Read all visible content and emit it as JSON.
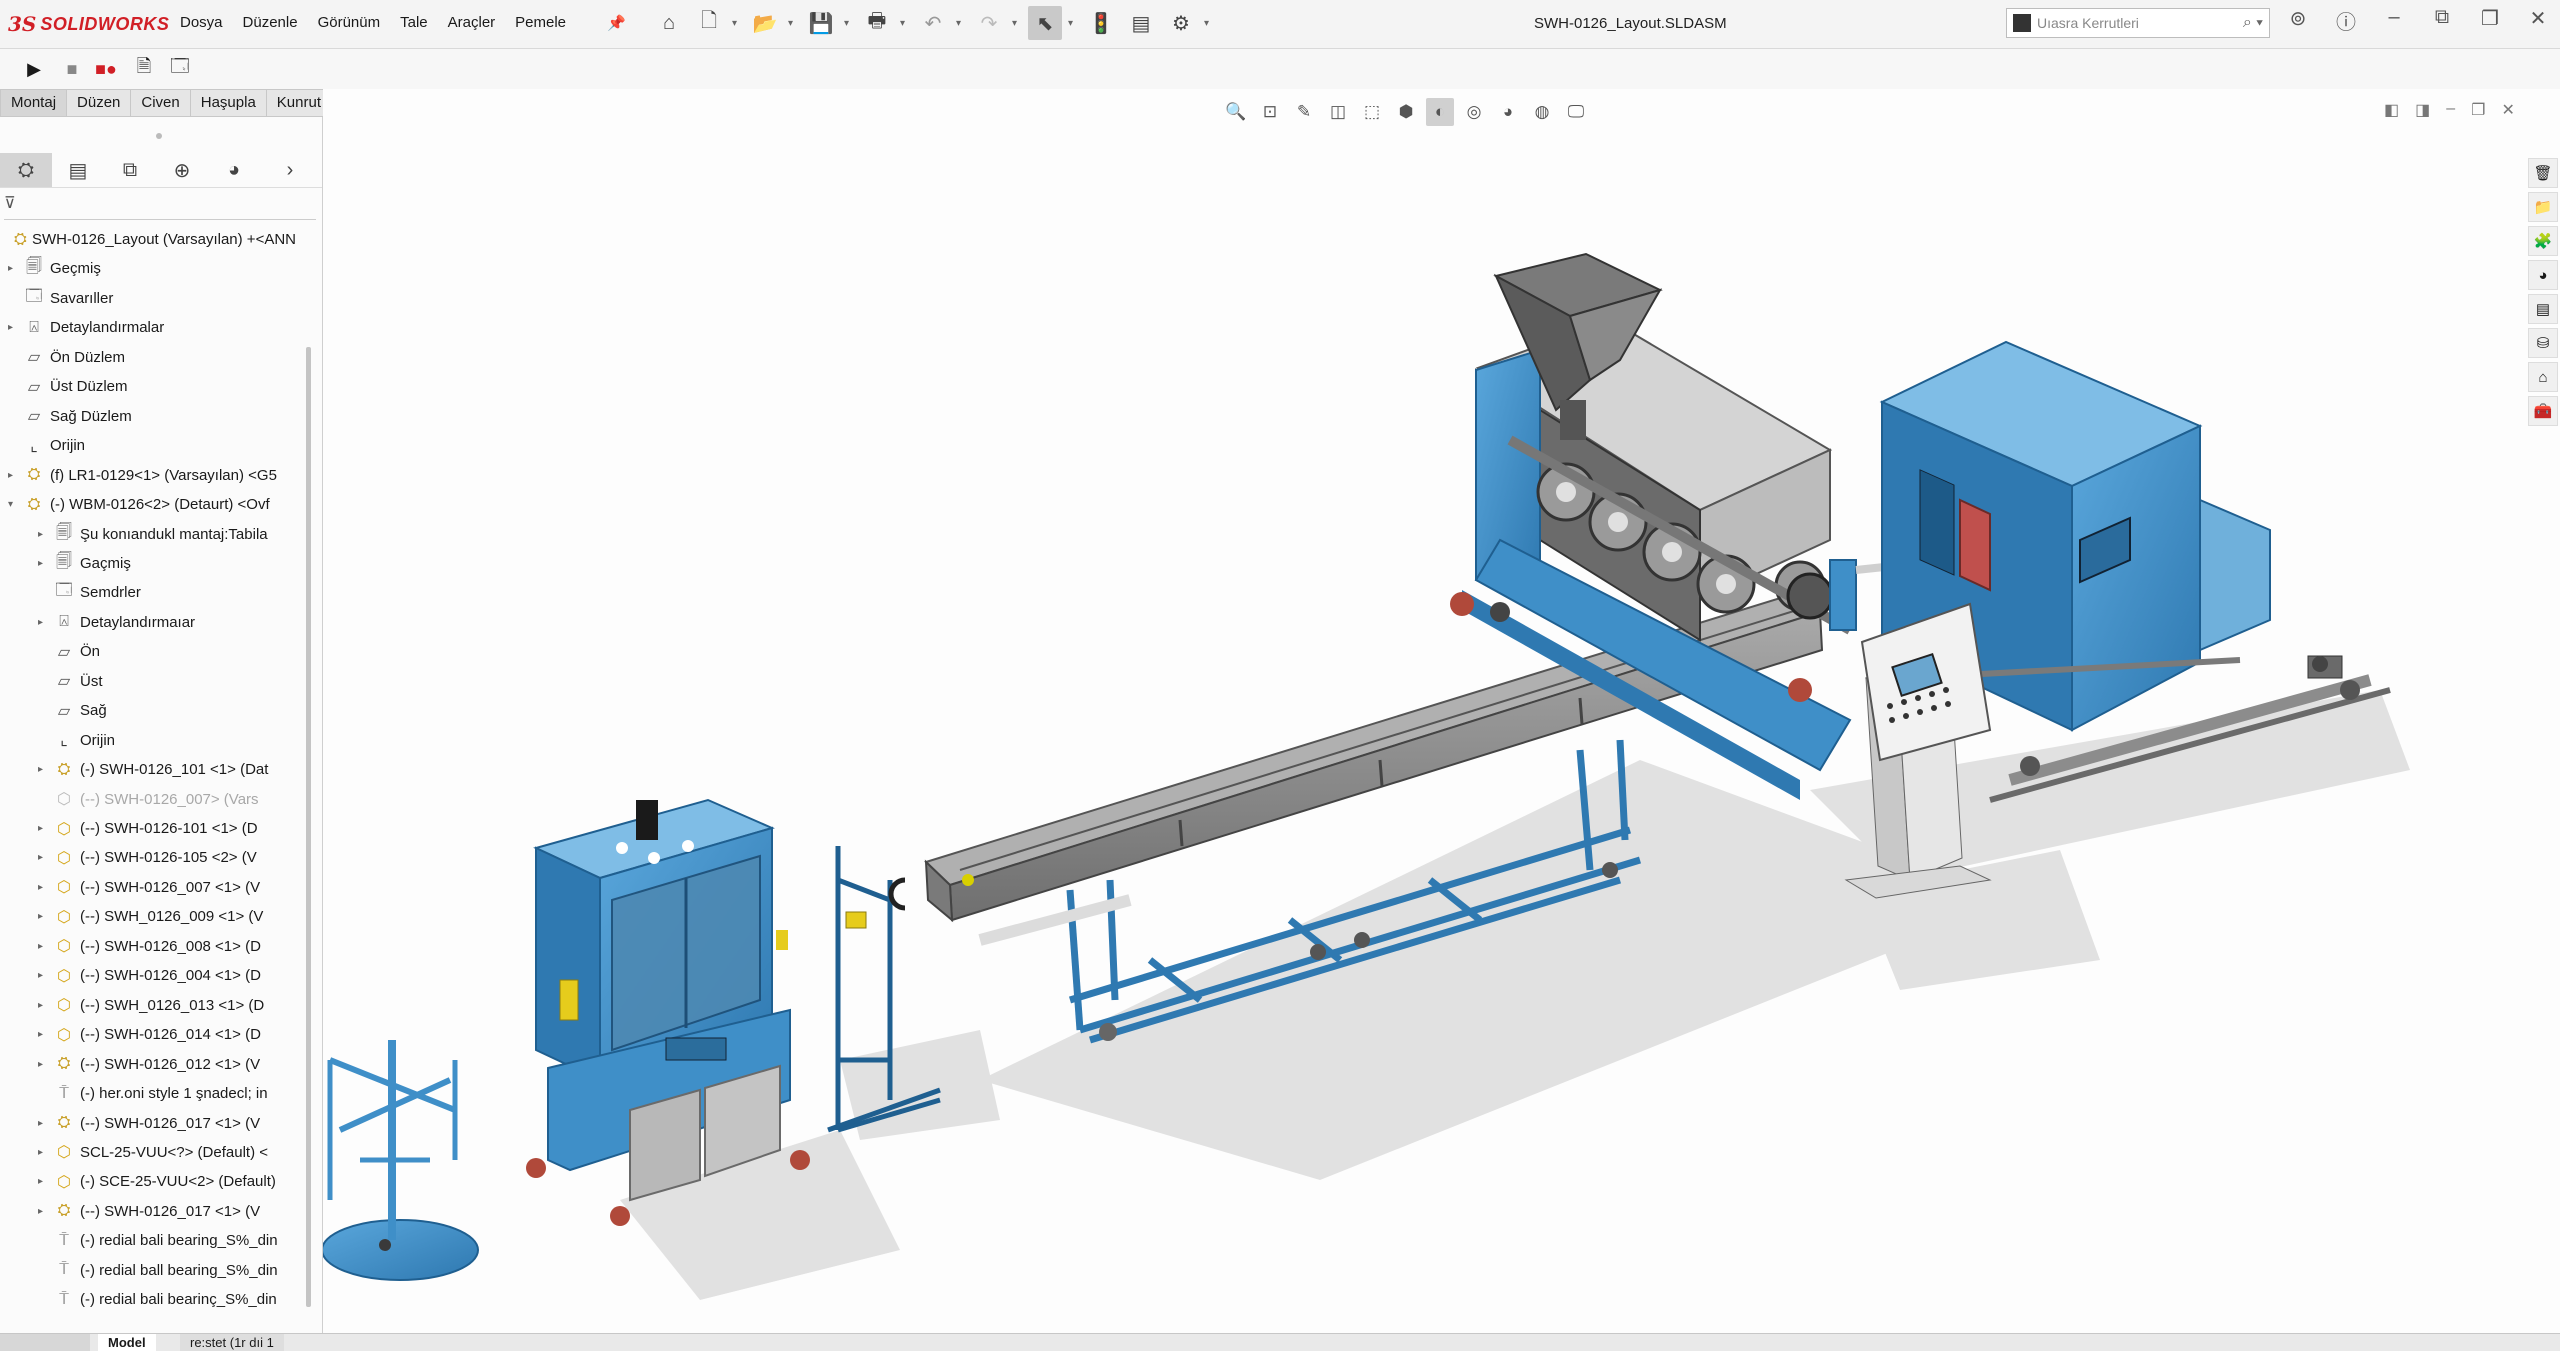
{
  "app": {
    "logo_prefix": "3S",
    "logo_name": "SOLIDWORKS"
  },
  "menu": [
    "Dosya",
    "Düzenle",
    "Görünüm",
    "Tale",
    "Araçler",
    "Pemele"
  ],
  "document_title": "SWH-0126_Layout.SLDASM",
  "search": {
    "placeholder": "Uıasra Kerrutleri"
  },
  "command_tabs": [
    "Montaj",
    "Düzen",
    "Civen",
    "Haşupla",
    "Kunrut Telentiri (Exita)"
  ],
  "active_command_tab": 0,
  "tree": [
    {
      "label": "SWH-0126_Layout (Varsayılan) +<ANN",
      "icon": "assembly-icon",
      "indent": 0,
      "expand": ""
    },
    {
      "label": "Geçmiş",
      "icon": "history-icon",
      "indent": 1,
      "expand": "▸"
    },
    {
      "label": "Savarıller",
      "icon": "sensors-icon",
      "indent": 1,
      "expand": ""
    },
    {
      "label": "Detaylandırmalar",
      "icon": "annotations-icon",
      "indent": 1,
      "expand": "▸"
    },
    {
      "label": "Ön Düzlem",
      "icon": "plane-icon",
      "indent": 1,
      "expand": ""
    },
    {
      "label": "Üst Düzlem",
      "icon": "plane-icon",
      "indent": 1,
      "expand": ""
    },
    {
      "label": "Sağ Düzlem",
      "icon": "plane-icon",
      "indent": 1,
      "expand": ""
    },
    {
      "label": "Orijin",
      "icon": "origin-icon",
      "indent": 1,
      "expand": ""
    },
    {
      "label": "(f) LR1-0129<1> (Varsayılan) <G5",
      "icon": "subassembly-icon",
      "indent": 1,
      "expand": "▸"
    },
    {
      "label": "(-) WBM-0126<2> (Detaurt) <Ovf",
      "icon": "subassembly-icon",
      "indent": 1,
      "expand": "▾"
    },
    {
      "label": "Şu konıandukl mantaj:Tabila",
      "icon": "history-icon",
      "indent": 2,
      "expand": "▸"
    },
    {
      "label": "Gaçmiş",
      "icon": "history-icon",
      "indent": 2,
      "expand": "▸"
    },
    {
      "label": "Semdrler",
      "icon": "sensors-icon",
      "indent": 2,
      "expand": ""
    },
    {
      "label": "Detaylandırmaıar",
      "icon": "annotations-icon",
      "indent": 2,
      "expand": "▸"
    },
    {
      "label": "Ön",
      "icon": "plane-icon",
      "indent": 2,
      "expand": ""
    },
    {
      "label": "Üst",
      "icon": "plane-icon",
      "indent": 2,
      "expand": ""
    },
    {
      "label": "Sağ",
      "icon": "plane-icon",
      "indent": 2,
      "expand": ""
    },
    {
      "label": "Orijin",
      "icon": "origin-icon",
      "indent": 2,
      "expand": ""
    },
    {
      "label": "(-) SWH-0126_101 <1> (Dat",
      "icon": "subassembly-icon",
      "indent": 2,
      "expand": "▸"
    },
    {
      "label": "(--) SWH-0126_007> (Vars",
      "icon": "part-dim-icon",
      "indent": 2,
      "expand": "",
      "dim": true
    },
    {
      "label": "(--) SWH-0126-101 <1> (D",
      "icon": "part-icon",
      "indent": 2,
      "expand": "▸"
    },
    {
      "label": "(--) SWH-0126-105 <2> (V",
      "icon": "part-icon",
      "indent": 2,
      "expand": "▸"
    },
    {
      "label": "(--) SWH-0126_007 <1> (V",
      "icon": "part-icon",
      "indent": 2,
      "expand": "▸"
    },
    {
      "label": "(--) SWH_0126_009 <1> (V",
      "icon": "part-edit-icon",
      "indent": 2,
      "expand": "▸"
    },
    {
      "label": "(--) SWH-0126_008 <1> (D",
      "icon": "part-icon",
      "indent": 2,
      "expand": "▸"
    },
    {
      "label": "(--) SWH-0126_004 <1> (D",
      "icon": "part-icon",
      "indent": 2,
      "expand": "▸"
    },
    {
      "label": "(--) SWH_0126_013 <1> (D",
      "icon": "part-icon",
      "indent": 2,
      "expand": "▸"
    },
    {
      "label": "(--) SWH-0126_014 <1> (D",
      "icon": "part-icon",
      "indent": 2,
      "expand": "▸"
    },
    {
      "label": "(--) SWH-0126_012 <1> (V",
      "icon": "subassembly-icon",
      "indent": 2,
      "expand": "▸"
    },
    {
      "label": "(-) her.oni style 1 şnadecl; in",
      "icon": "toolbox-icon",
      "indent": 2,
      "expand": ""
    },
    {
      "label": "(--) SWH-0126_017 <1> (V",
      "icon": "subassembly-icon",
      "indent": 2,
      "expand": "▸"
    },
    {
      "label": "SCL-25-VUU<?> (Default) <",
      "icon": "part-icon",
      "indent": 2,
      "expand": "▸"
    },
    {
      "label": "(-) SCE-25-VUU<2> (Default)",
      "icon": "part-icon",
      "indent": 2,
      "expand": "▸"
    },
    {
      "label": "(--) SWH-0126_017 <1> (V",
      "icon": "subassembly-icon",
      "indent": 2,
      "expand": "▸"
    },
    {
      "label": "(-) redial bali bearing_S%_din",
      "icon": "toolbox-icon",
      "indent": 2,
      "expand": ""
    },
    {
      "label": "(-) redial ball bearing_S%_din",
      "icon": "toolbox-icon",
      "indent": 2,
      "expand": ""
    },
    {
      "label": "(-) redial bali bearinç_S%_din",
      "icon": "toolbox-icon",
      "indent": 2,
      "expand": ""
    }
  ],
  "bottom_tabs": [
    "Model",
    "re:stet (1r dıi 1"
  ],
  "colors": {
    "machine_blue": "#3f8fc8",
    "machine_dark": "#1f5f90",
    "frame_gray": "#8c8c8c",
    "accent_red": "#d11f26"
  }
}
